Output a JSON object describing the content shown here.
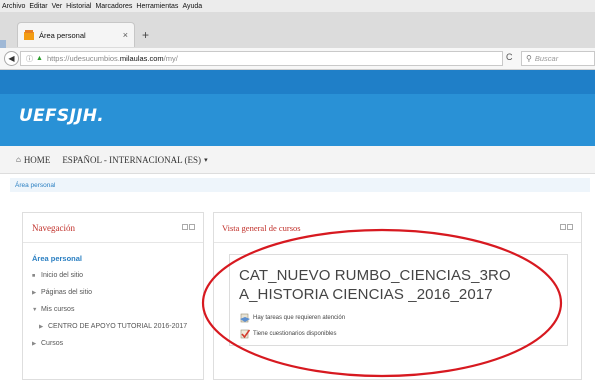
{
  "browser": {
    "menu": [
      {
        "label": "Archivo"
      },
      {
        "label": "Editar"
      },
      {
        "label": "Ver"
      },
      {
        "label": "Historial"
      },
      {
        "label": "Marcadores"
      },
      {
        "label": "Herramientas"
      },
      {
        "label": "Ayuda"
      }
    ],
    "tab_title": "Área personal",
    "tab_close": "×",
    "new_tab": "+",
    "url_prefix": "https://udesucumbios.",
    "url_host": "milaulas.com",
    "url_suffix": "/my/",
    "search_placeholder": "Buscar"
  },
  "site": {
    "name": "UEFSJJH.",
    "menu": [
      {
        "label": "HOME",
        "icon": "home-icon"
      },
      {
        "label": "ESPAÑOL - INTERNACIONAL (ES)",
        "icon": "chevron-down-icon"
      }
    ],
    "breadcrumb": "Área personal",
    "accent": "#2991d6",
    "block_title_color": "#c1302a"
  },
  "navigation": {
    "title": "Navegación",
    "root": "Área personal",
    "items": [
      {
        "label": "Inicio del sitio",
        "bullet": "■"
      },
      {
        "label": "Páginas del sitio",
        "bullet": "▶"
      },
      {
        "label": "Mis cursos",
        "bullet": "▼"
      },
      {
        "label": "CENTRO DE APOYO TUTORIAL 2016-2017",
        "bullet": "▶"
      },
      {
        "label": "Cursos",
        "bullet": "▶"
      }
    ]
  },
  "overview": {
    "title": "Vista general de cursos",
    "course_title": "CAT_NUEVO RUMBO_CIENCIAS_3ROA_HISTORIA CIENCIAS _2016_2017",
    "course_title_line1": "CAT_NUEVO RUMBO_CIENCIAS_3RO",
    "course_title_line2": "A_HISTORIA CIENCIAS _2016_2017",
    "notices": [
      {
        "label": "Hay tareas que requieren atención",
        "icon": "assignment-icon"
      },
      {
        "label": "Tiene cuestionarios disponibles",
        "icon": "quiz-icon"
      }
    ]
  }
}
